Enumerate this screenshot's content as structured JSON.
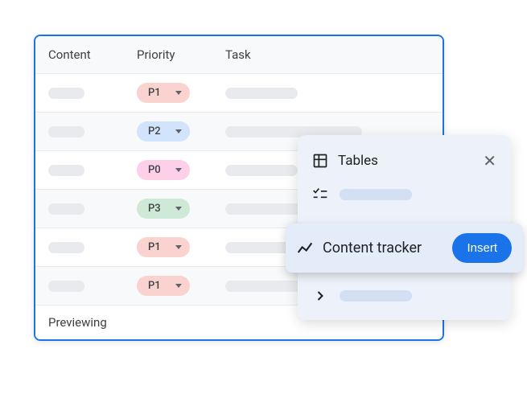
{
  "table": {
    "headers": {
      "content": "Content",
      "priority": "Priority",
      "task": "Task"
    },
    "rows": [
      {
        "priority": "P1",
        "pclass": "p1",
        "tshort": true,
        "alt": false
      },
      {
        "priority": "P2",
        "pclass": "p2",
        "tshort": false,
        "alt": true
      },
      {
        "priority": "P0",
        "pclass": "p0",
        "tshort": true,
        "alt": false
      },
      {
        "priority": "P3",
        "pclass": "p3",
        "tshort": false,
        "alt": true
      },
      {
        "priority": "P1",
        "pclass": "p1",
        "tshort": true,
        "alt": false
      },
      {
        "priority": "P1",
        "pclass": "p1",
        "tshort": false,
        "alt": true
      }
    ],
    "footer": "Previewing"
  },
  "popup": {
    "title": "Tables",
    "highlighted": {
      "label": "Content tracker",
      "button": "Insert"
    }
  }
}
